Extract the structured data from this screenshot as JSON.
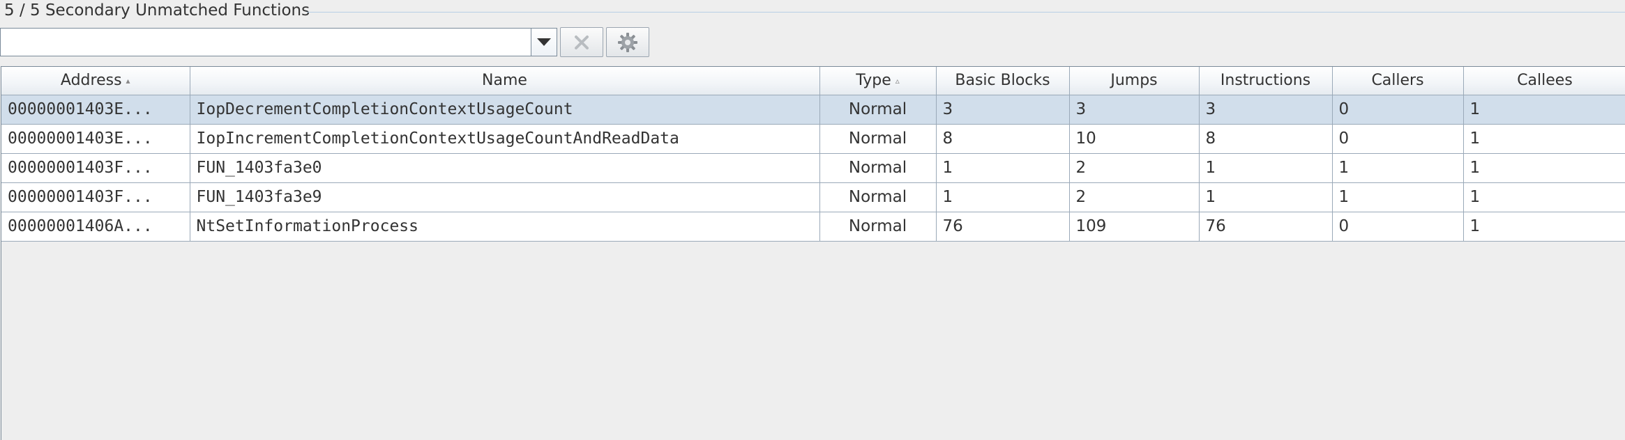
{
  "panel": {
    "title": "5 / 5 Secondary Unmatched Functions"
  },
  "filter": {
    "value": "",
    "placeholder": ""
  },
  "toolbar": {
    "dropdown_icon": "chevron-down-icon",
    "clear_icon": "close-icon",
    "settings_icon": "gear-icon"
  },
  "colors": {
    "selected_row": "#d1deeb",
    "grid_line": "#9aa9b8"
  },
  "table": {
    "columns": [
      "Address",
      "Name",
      "Type",
      "Basic Blocks",
      "Jumps",
      "Instructions",
      "Callers",
      "Callees"
    ],
    "sorted_columns": [
      "Address",
      "Type"
    ],
    "selected_row": 0,
    "rows": [
      {
        "address": "00000001403E...",
        "name": "IopDecrementCompletionContextUsageCount",
        "type": "Normal",
        "basic_blocks": "3",
        "jumps": "3",
        "instructions": "3",
        "callers": "0",
        "callees": "1"
      },
      {
        "address": "00000001403E...",
        "name": "IopIncrementCompletionContextUsageCountAndReadData",
        "type": "Normal",
        "basic_blocks": "8",
        "jumps": "10",
        "instructions": "8",
        "callers": "0",
        "callees": "1"
      },
      {
        "address": "00000001403F...",
        "name": "FUN_1403fa3e0",
        "type": "Normal",
        "basic_blocks": "1",
        "jumps": "2",
        "instructions": "1",
        "callers": "1",
        "callees": "1"
      },
      {
        "address": "00000001403F...",
        "name": "FUN_1403fa3e9",
        "type": "Normal",
        "basic_blocks": "1",
        "jumps": "2",
        "instructions": "1",
        "callers": "1",
        "callees": "1"
      },
      {
        "address": "00000001406A...",
        "name": "NtSetInformationProcess",
        "type": "Normal",
        "basic_blocks": "76",
        "jumps": "109",
        "instructions": "76",
        "callers": "0",
        "callees": "1"
      }
    ]
  }
}
